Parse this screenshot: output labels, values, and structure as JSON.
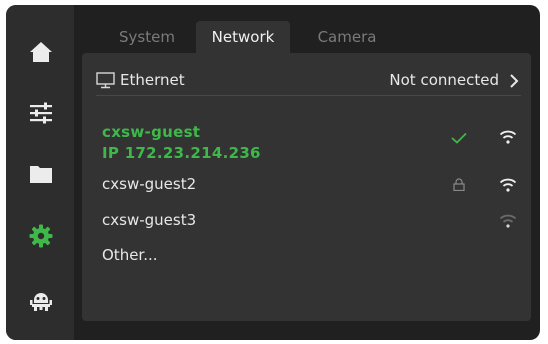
{
  "sidebar": {
    "items": [
      {
        "name": "home",
        "icon": "home-icon",
        "active": false
      },
      {
        "name": "settings-sliders",
        "icon": "sliders-icon",
        "active": false
      },
      {
        "name": "files",
        "icon": "folder-icon",
        "active": false
      },
      {
        "name": "settings",
        "icon": "gear-icon",
        "active": true
      },
      {
        "name": "robot",
        "icon": "robot-icon",
        "active": false
      }
    ]
  },
  "tabs": [
    {
      "label": "System",
      "active": false
    },
    {
      "label": "Network",
      "active": true
    },
    {
      "label": "Camera",
      "active": false
    }
  ],
  "ethernet": {
    "label": "Ethernet",
    "status": "Not connected"
  },
  "networks": [
    {
      "name": "cxsw-guest",
      "ip": "IP  172.23.214.236",
      "connected": true,
      "locked": false,
      "signal": "strong"
    },
    {
      "name": "cxsw-guest2",
      "connected": false,
      "locked": true,
      "signal": "strong"
    },
    {
      "name": "cxsw-guest3",
      "connected": false,
      "locked": false,
      "signal": "weak"
    }
  ],
  "other_label": "Other...",
  "colors": {
    "accent": "#3fb84a",
    "background": "#202020",
    "panel": "#333333",
    "sidebar": "#2d2d2d"
  }
}
